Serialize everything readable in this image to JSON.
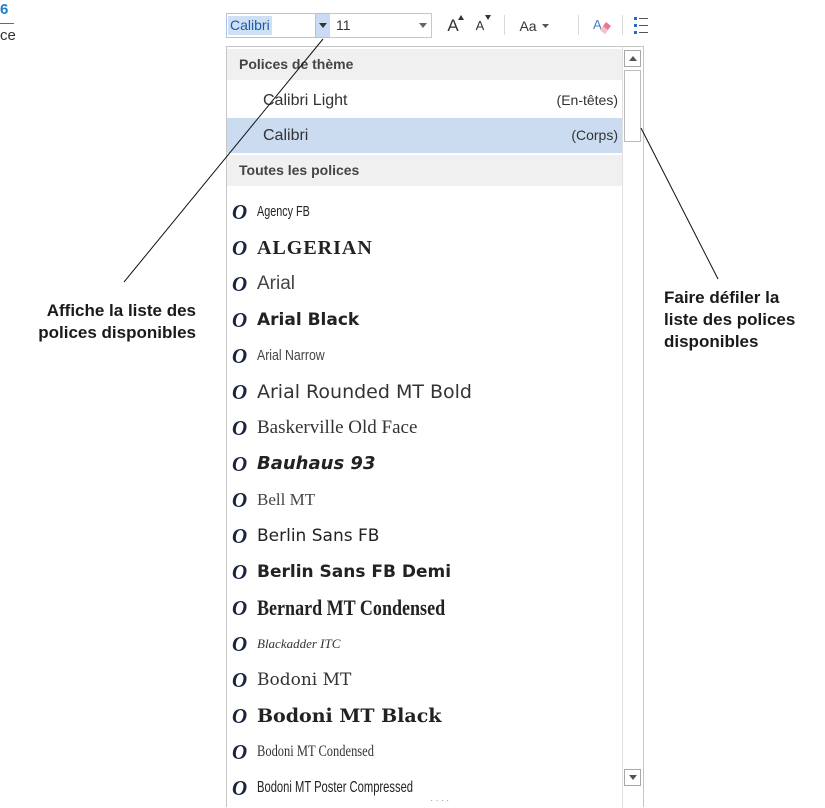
{
  "figure": {
    "number": "6",
    "caption_fragment": "ce"
  },
  "ribbon": {
    "font_name": "Calibri",
    "font_size": "11",
    "grow_label": "A",
    "shrink_label": "A",
    "change_case_label": "Aa"
  },
  "dropdown": {
    "theme_header": "Polices de thème",
    "theme_fonts": [
      {
        "name": "Calibri Light",
        "tag": "(En-têtes)",
        "selected": false
      },
      {
        "name": "Calibri",
        "tag": "(Corps)",
        "selected": true
      }
    ],
    "all_header": "Toutes les polices",
    "fonts": [
      "Agency FB",
      "ALGERIAN",
      "Arial",
      "Arial Black",
      "Arial Narrow",
      "Arial Rounded MT Bold",
      "Baskerville Old Face",
      "Bauhaus 93",
      "Bell MT",
      "Berlin Sans FB",
      "Berlin Sans FB Demi",
      "Bernard MT Condensed",
      "Blackadder ITC",
      "Bodoni MT",
      "Bodoni MT Black",
      "Bodoni MT Condensed",
      "Bodoni MT Poster Compressed"
    ]
  },
  "callouts": {
    "left_line1": "Affiche la liste des",
    "left_line2": "polices disponibles",
    "right_line1": "Faire défiler la",
    "right_line2": "liste des polices",
    "right_line3": "disponibles"
  },
  "icons": [
    "dropdown-arrow-icon",
    "grow-font-icon",
    "shrink-font-icon",
    "clear-formatting-icon",
    "bullets-icon",
    "scroll-up-icon",
    "scroll-down-icon",
    "font-type-icon"
  ]
}
